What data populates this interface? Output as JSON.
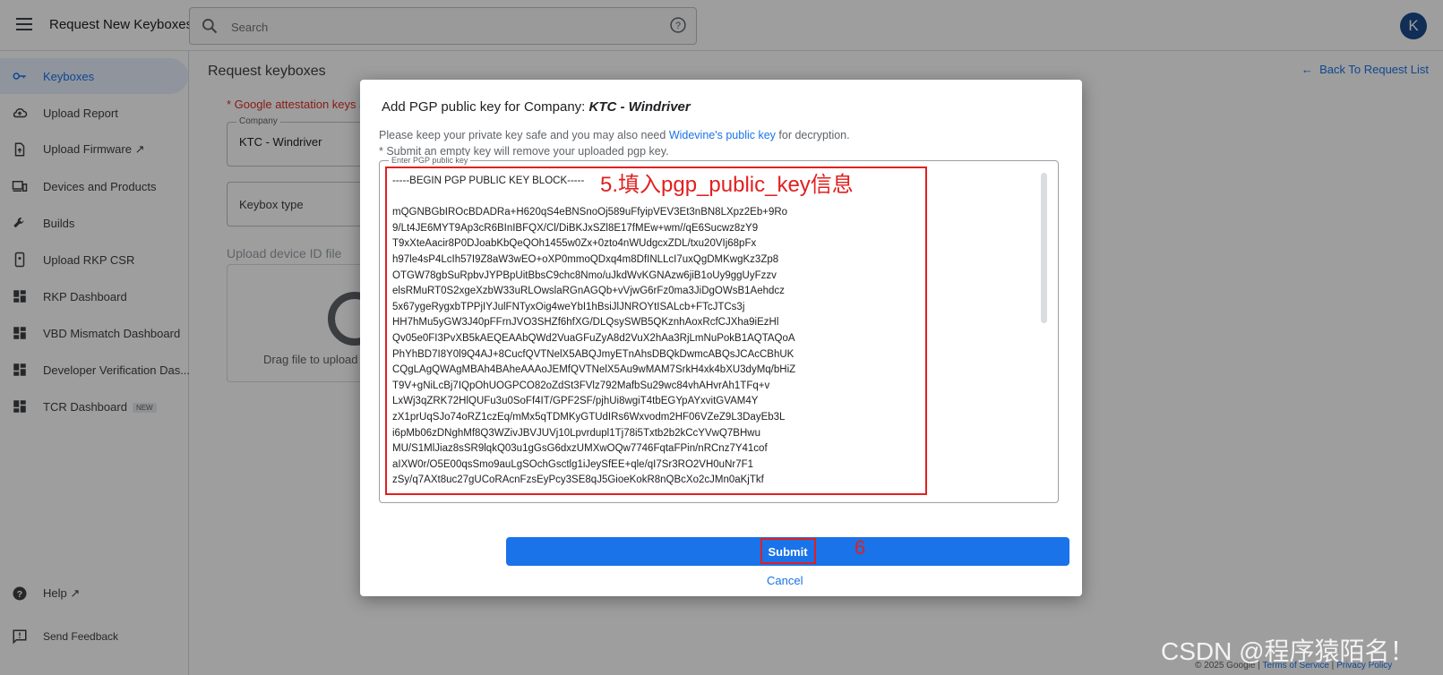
{
  "header": {
    "app_title": "Request New Keyboxes",
    "search_placeholder": "Search",
    "avatar_letter": "K"
  },
  "sidebar": {
    "items": [
      {
        "label": "Keyboxes",
        "icon": "key-icon",
        "active": true
      },
      {
        "label": "Upload Report",
        "icon": "cloud-upload-icon"
      },
      {
        "label": "Upload Firmware ↗",
        "icon": "file-upload-icon"
      },
      {
        "label": "Devices and Products",
        "icon": "devices-icon"
      },
      {
        "label": "Builds",
        "icon": "wrench-icon"
      },
      {
        "label": "Upload RKP CSR",
        "icon": "phone-icon"
      },
      {
        "label": "RKP Dashboard",
        "icon": "dashboard-icon"
      },
      {
        "label": "VBD Mismatch Dashboard",
        "icon": "dashboard-icon"
      },
      {
        "label": "Developer Verification Das...",
        "icon": "dashboard-icon"
      },
      {
        "label": "TCR Dashboard",
        "icon": "dashboard-icon",
        "badge": "NEW"
      }
    ],
    "help_label": "Help ↗",
    "feedback_label": "Send Feedback"
  },
  "main": {
    "page_title": "Request keyboxes",
    "back_link": "Back To Request List",
    "warning_text": "* Google attestation keys a",
    "company_label": "Company",
    "company_value": "KTC - Windriver",
    "keybox_type_placeholder": "Keybox type",
    "upload_label": "Upload device ID file",
    "drop_text": "Drag file to upload"
  },
  "footer": {
    "copyright": "© 2025 Google",
    "sep": "|",
    "terms": "Terms of Service",
    "privacy": "Privacy Policy"
  },
  "dialog": {
    "title_prefix": "Add PGP public key for Company: ",
    "company": "KTC - Windriver",
    "info_pre": "Please keep your private key safe and you may also need ",
    "info_link": "Widevine's public key",
    "info_post": " for decryption.",
    "note": "* Submit an empty key will remove your uploaded pgp key.",
    "field_label": "Enter PGP public key",
    "key_header": "-----BEGIN PGP PUBLIC KEY BLOCK-----",
    "key_lines": [
      "mQGNBGbIROcBDADRa+H620qS4eBNSnoOj589uFfyipVEV3Et3nBN8LXpz2Eb+9Ro",
      "9/Lt4JE6MYT9Ap3cR6BInIBFQX/Cl/DiBKJxSZl8E17fMEw+wm//qE6Sucwz8zY9",
      "T9xXteAacir8P0DJoabKbQeQOh1455w0Zx+0zto4nWUdgcxZDL/txu20VIj68pFx",
      "h97le4sP4LcIh57I9Z8aW3wEO+oXP0mmoQDxq4m8DfINLLcI7uxQgDMKwgKz3Zp8",
      "OTGW78gbSuRpbvJYPBpUitBbsC9chc8Nmo/uJkdWvKGNAzw6jiB1oUy9ggUyFzzv",
      "elsRMuRT0S2xgeXzbW33uRLOwslaRGnAGQb+vVjwG6rFz0ma3JiDgOWsB1Aehdcz",
      "5x67ygeRygxbTPPjIYJulFNTyxOig4weYbI1hBsiJlJNROYtISALcb+FTcJTCs3j",
      "HH7hMu5yGW3J40pFFrnJVO3SHZf6hfXG/DLQsySWB5QKznhAoxRcfCJXha9iEzHl",
      "Qv05e0FI3PvXB5kAEQEAAbQWd2VuaGFuZyA8d2VuX2hAa3RjLmNuPokB1AQTAQoA",
      "PhYhBD7I8Y0l9Q4AJ+8CucfQVTNelX5ABQJmyETnAhsDBQkDwmcABQsJCAcCBhUK",
      "CQgLAgQWAgMBAh4BAheAAAoJEMfQVTNelX5Au9wMAM7SrkH4xk4bXU3dyMq/bHiZ",
      "T9V+gNiLcBj7IQpOhUOGPCO82oZdSt3FVlz792MafbSu29wc84vhAHvrAh1TFq+v",
      "LxWj3qZRK72HlQUFu3u0SoFf4IT/GPF2SF/pjhUi8wgiT4tbEGYpAYxvitGVAM4Y",
      "zX1prUqSJo74oRZ1czEq/mMx5qTDMKyGTUdIRs6Wxvodm2HF06VZeZ9L3DayEb3L",
      "i6pMb06zDNghMf8Q3WZivJBVJUVj10Lpvrdupl1Tj78i5Txtb2b2kCcYVwQ7BHwu",
      "MU/S1MlJiaz8sSR9lqkQ03u1gGsG6dxzUMXwOQw7746FqtaFPin/nRCnz7Y41cof",
      "aIXW0r/O5E00qsSmo9auLgSOchGsctlg1iJeySfEE+qle/qI7Sr3RO2VH0uNr7F1",
      "zSy/q7AXt8uc27gUCoRAcnFzsEyPcy3SE8qJ5GioeKokR8nQBcXo2cJMn0aKjTkf"
    ],
    "annotation_step5": "5.填入pgp_public_key信息",
    "submit_label": "Submit",
    "annotation_step6": "6",
    "cancel_label": "Cancel"
  },
  "watermark": "CSDN @程序猿陌名！",
  "colors": {
    "accent": "#1a73e8",
    "annotation": "#e02020",
    "warning": "#d93025"
  }
}
